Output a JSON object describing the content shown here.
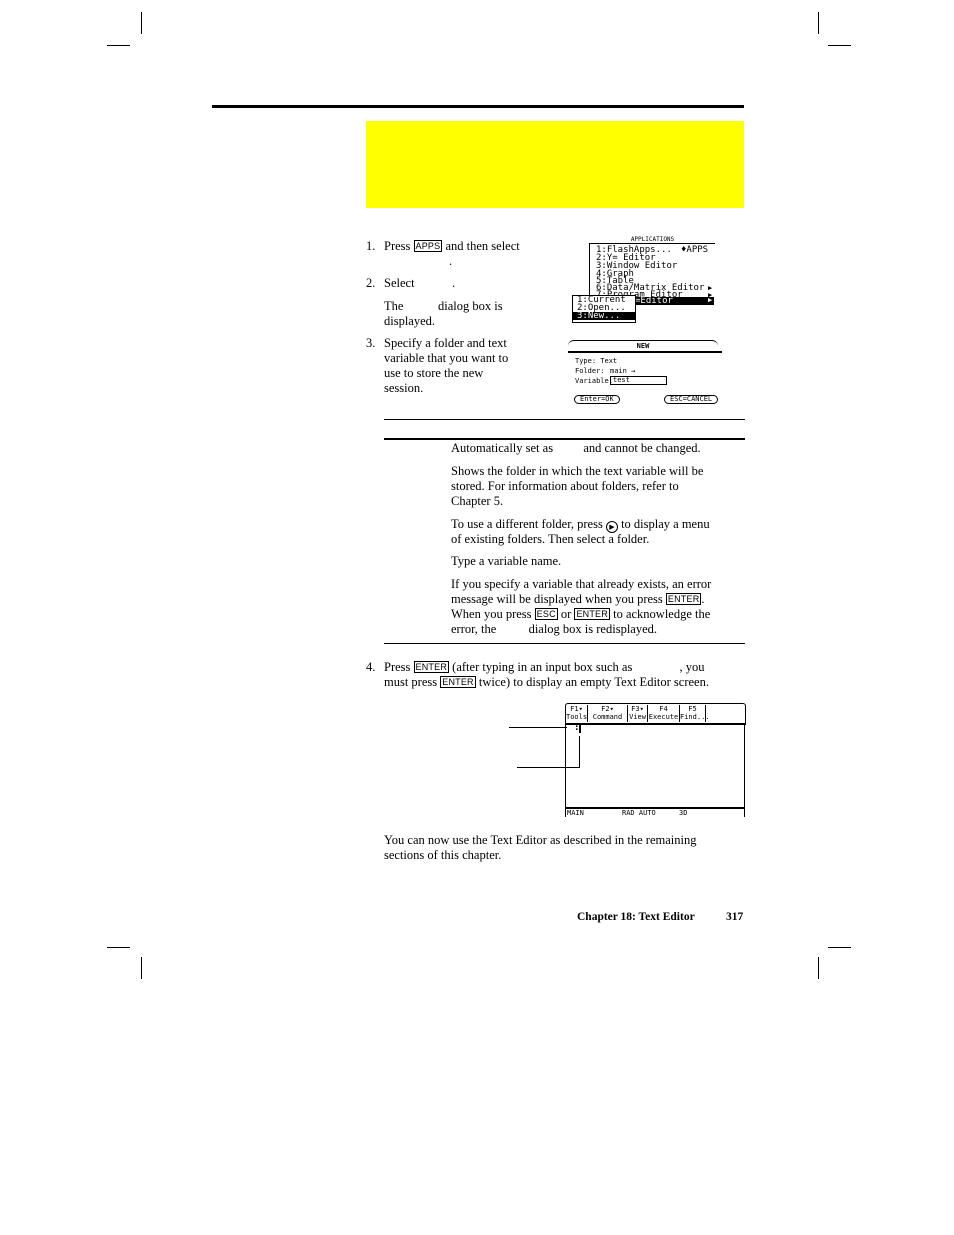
{
  "steps": {
    "step1": {
      "number": "1.",
      "line1_before": "Press",
      "key": "APPS",
      "line1_after": "and then select",
      "line2": "."
    },
    "step2": {
      "number": "2.",
      "text": "Select",
      "trail": ".",
      "note_before": "The",
      "note_after": "dialog box is",
      "note_line2": "displayed."
    },
    "step3": {
      "number": "3.",
      "lines": [
        "Specify a folder and text",
        "variable that you want to",
        "use to store the new",
        "session."
      ]
    },
    "step4": {
      "number": "4.",
      "l1_a": "Press",
      "key_enter": "ENTER",
      "l1_b": "(after typing in an input box such as",
      "l1_c": ", you",
      "l2_a": "must press",
      "l2_b": "twice) to display an empty Text Editor screen."
    }
  },
  "table": {
    "rows": [
      {
        "paras": [
          [
            "Automatically set as",
            "and cannot be changed."
          ]
        ]
      },
      {
        "paras": [
          [
            "Shows the folder in which the text variable will be",
            "stored. For information about folders, refer to",
            "Chapter 5."
          ],
          [
            "To use a different folder, press",
            "to display a menu",
            "of existing folders. Then select a folder."
          ]
        ]
      },
      {
        "paras": [
          [
            "Type a variable name."
          ],
          [
            "If you specify a variable that already exists, an error",
            "message will be displayed when you press",
            "When you press",
            "or",
            "to acknowledge the",
            "error, the",
            "dialog box is redisplayed."
          ]
        ]
      }
    ],
    "keys": {
      "right_arrow": "▶",
      "enter": "ENTER",
      "esc": "ESC"
    }
  },
  "closing": [
    "You can now use the Text Editor as described in the remaining",
    "sections of this chapter."
  ],
  "footer": {
    "chapter": "Chapter 18: Text Editor",
    "page": "317"
  },
  "screen_apps": {
    "title": "APPLICATIONS",
    "items": [
      "1:FlashApps...",
      "2:Y= Editor",
      "3:Window Editor",
      "4:Graph",
      "5:Table",
      "6:Data/Matrix Editor",
      "7:Program Editor"
    ],
    "flash_shortcut": "♦APPS",
    "highlighted": "=Editor",
    "submenu": [
      "1:Current",
      "2:Open...",
      "3:New..."
    ]
  },
  "screen_new": {
    "title": "NEW",
    "type_label": "Type: Text",
    "folder_label": "Folder:",
    "folder_value": "main →",
    "variable_label": "Variable:",
    "variable_value": "test",
    "ok_button": "Enter=OK",
    "cancel_button": "ESC=CANCEL"
  },
  "screen_editor": {
    "tabs": [
      {
        "key": "F1▾",
        "label": "Tools"
      },
      {
        "key": "F2▾",
        "label": "Command"
      },
      {
        "key": "F3▾",
        "label": "View"
      },
      {
        "key": "F4",
        "label": "Execute"
      },
      {
        "key": "F5",
        "label": "Find..."
      }
    ],
    "prompt": ":",
    "status": {
      "folder": "MAIN",
      "mode": "RAD AUTO",
      "graph": "3D"
    }
  },
  "colors": {
    "highlight_band": "#ffff00"
  }
}
